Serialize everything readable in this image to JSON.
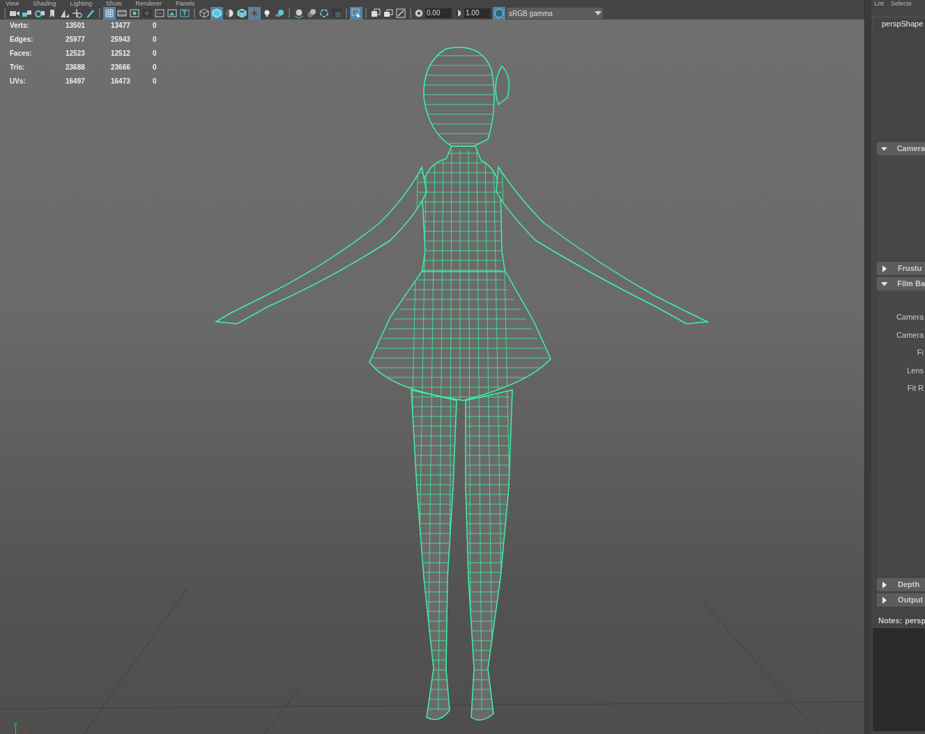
{
  "menu": [
    "View",
    "Shading",
    "Lighting",
    "Show",
    "Renderer",
    "Panels"
  ],
  "toolbar": {
    "groups": [
      [
        {
          "selected": false
        },
        {
          "selected": false
        },
        {
          "selected": false
        },
        {
          "selected": false
        },
        {
          "selected": false
        },
        {
          "selected": false
        },
        {
          "selected": false
        }
      ],
      [
        {
          "selected": true
        },
        {
          "selected": false
        },
        {
          "selected": false
        },
        {
          "selected": false
        },
        {
          "selected": false
        },
        {
          "selected": false
        },
        {
          "selected": false
        }
      ],
      [
        {
          "selected": false
        },
        {
          "selected": true
        },
        {
          "selected": false
        },
        {
          "selected": false
        },
        {
          "selected": true
        },
        {
          "selected": false
        },
        {
          "selected": false
        }
      ],
      [
        {
          "selected": false
        },
        {
          "selected": false
        },
        {
          "selected": false
        },
        {
          "selected": false
        }
      ],
      [
        {
          "selected": true
        }
      ],
      [
        {
          "selected": false
        },
        {
          "selected": false
        },
        {
          "selected": false
        }
      ]
    ],
    "exposure": "0.00",
    "gamma": "1.00",
    "color_management_on": true,
    "view_transform": "sRGB gamma"
  },
  "stats": [
    {
      "label": "Verts:",
      "values": [
        "13501",
        "13477",
        "0"
      ]
    },
    {
      "label": "Edges:",
      "values": [
        "25977",
        "25943",
        "0"
      ]
    },
    {
      "label": "Faces:",
      "values": [
        "12523",
        "12512",
        "0"
      ]
    },
    {
      "label": "Tris:",
      "values": [
        "23688",
        "23666",
        "0"
      ]
    },
    {
      "label": "UVs:",
      "values": [
        "16497",
        "16473",
        "0"
      ]
    }
  ],
  "axis": {
    "y": "y",
    "x": "x"
  },
  "attribute_editor": {
    "menu": [
      "List",
      "Selecte"
    ],
    "tab": "perspShape",
    "sections": [
      {
        "title": "Camera",
        "expanded": true
      },
      {
        "title": "Frustu",
        "expanded": false
      },
      {
        "title": "Film Ba",
        "expanded": true,
        "fields": [
          "Camera",
          "Camera",
          "Fi",
          "Lens",
          "Fit R"
        ]
      },
      {
        "title": "Depth",
        "expanded": false
      },
      {
        "title": "Output",
        "expanded": false
      }
    ],
    "notes_label": "Notes:",
    "notes_object": "persp"
  }
}
